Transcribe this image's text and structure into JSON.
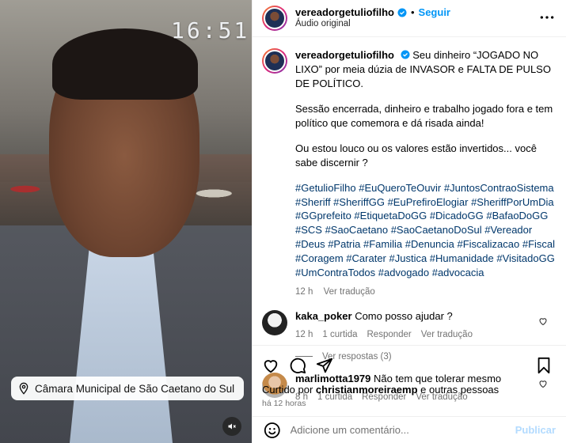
{
  "video": {
    "timestamp": "16:51",
    "location": "Câmara Municipal de São Caetano do Sul"
  },
  "header": {
    "username": "vereadorgetuliofilho",
    "follow_label": "Seguir",
    "audio_label": "Áudio original"
  },
  "caption": {
    "username": "vereadorgetuliofilho",
    "paragraph1": "Seu dinheiro “JOGADO NO LIXO” por meia dúzia de INVASOR e FALTA DE PULSO DE POLÍTICO.",
    "paragraph2": "Sessão encerrada, dinheiro e trabalho jogado fora e tem político que comemora e dá risada ainda!",
    "paragraph3": "Ou estou louco ou os valores estão invertidos... você sabe discernir ?",
    "hashtags": "#GetulioFilho #EuQueroTeOuvir #JuntosContraoSistema #Sheriff #SheriffGG #EuPrefiroElogiar #SheriffPorUmDia #GGprefeito #EtiquetaDoGG #DicadoGG #BafaoDoGG #SCS #SaoCaetano #SaoCaetanoDoSul #Vereador #Deus #Patria #Familia #Denuncia #Fiscalizacao #Fiscal #Coragem #Carater #Justica #Humanidade #VisitadoGG #UmContraTodos #advogado #advocacia",
    "time": "12 h",
    "translate": "Ver tradução"
  },
  "comments": [
    {
      "username": "kaka_poker",
      "text": "Como posso ajudar ?",
      "time": "12 h",
      "likes": "1 curtida",
      "reply": "Responder",
      "translate": "Ver tradução",
      "view_replies": "Ver respostas (3)"
    },
    {
      "username": "marlimotta1979",
      "text": "Não tem que tolerar mesmo",
      "time": "8 h",
      "likes": "1 curtida",
      "reply": "Responder",
      "translate": "Ver tradução"
    }
  ],
  "likes": {
    "prefix": "Curtido por ",
    "user": "christianmoreiraemp",
    "suffix": " e outras pessoas",
    "ago": "há 12 horas"
  },
  "comment_bar": {
    "placeholder": "Adicione um comentário...",
    "publish_label": "Publicar"
  },
  "icons": [
    "location-pin-icon",
    "muted-speaker-icon",
    "verified-badge-icon",
    "more-options-icon",
    "heart-icon",
    "comment-icon",
    "share-icon",
    "bookmark-icon",
    "emoji-icon"
  ],
  "colors": {
    "accent": "#0095f6",
    "hashtag": "#00376b",
    "muted": "#737373"
  }
}
